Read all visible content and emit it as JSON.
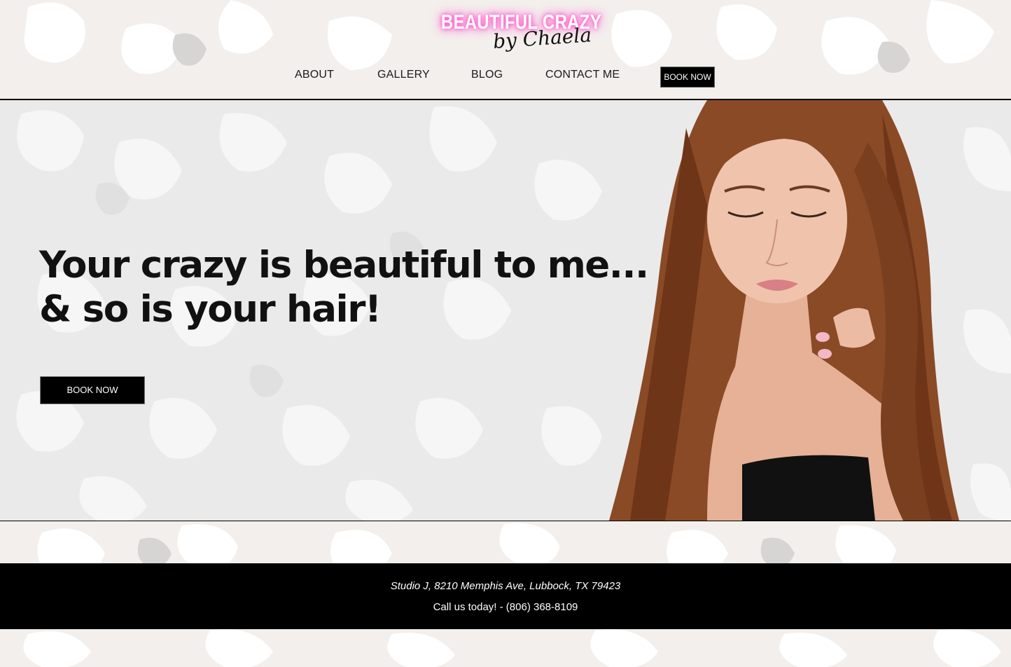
{
  "brand": {
    "title_top": "BEAUTIFUL CRAZY",
    "title_bottom": "by Chaela",
    "neon_color": "#ff4fc7"
  },
  "nav": {
    "items": [
      "ABOUT",
      "GALLERY",
      "BLOG",
      "CONTACT ME"
    ],
    "book_label": "BOOK NOW"
  },
  "hero": {
    "headline_line1": "Your crazy is beautiful to me...",
    "headline_line2": "& so is your hair!",
    "cta_label": "BOOK NOW",
    "image": "woman-long-brown-hair-photo"
  },
  "footer": {
    "address": "Studio J, 8210 Memphis Ave, Lubbock, TX 79423",
    "phone_line": "Call us today! - (806) 368-8109"
  },
  "colors": {
    "page_bg": "#f3efec",
    "hero_bg": "#eaeaea",
    "button_bg": "#000000",
    "text": "#111111"
  }
}
